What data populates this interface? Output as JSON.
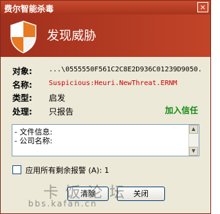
{
  "window": {
    "title": "费尔智能杀毒",
    "close_label": "×"
  },
  "header": {
    "title": "发现威胁"
  },
  "details": {
    "object_label": "对象:",
    "object_value": "...\\0555550F561C2C8E2D936C01239D9050.",
    "name_label": "名称:",
    "name_value": "Suspicious:Heuri.NewThreat.ERNM",
    "type_label": "类型:",
    "type_value": "启发",
    "action_label": "处理:",
    "action_value": "只报告"
  },
  "trust_link": "加入信任",
  "info_box": {
    "lines": [
      "- 文件信息:",
      "- 公司名称:"
    ]
  },
  "apply_all": {
    "label": "应用所有剩余报警 (A): 1",
    "checked": false
  },
  "buttons": {
    "left_partial": "清除",
    "close": "关闭"
  },
  "watermark": {
    "line1": "卡饭论坛",
    "line2": "bbs.kafan.cn"
  },
  "colors": {
    "title_bar": "#b03a20",
    "header_bg": "#b23b22",
    "link_green": "#128c12",
    "threat_red": "#cc0000",
    "dialog_bg": "#ece9d8"
  },
  "icons": {
    "shield": "shield-icon",
    "close": "close-icon",
    "scroll_up": "scroll-up-icon",
    "scroll_down": "scroll-down-icon"
  }
}
